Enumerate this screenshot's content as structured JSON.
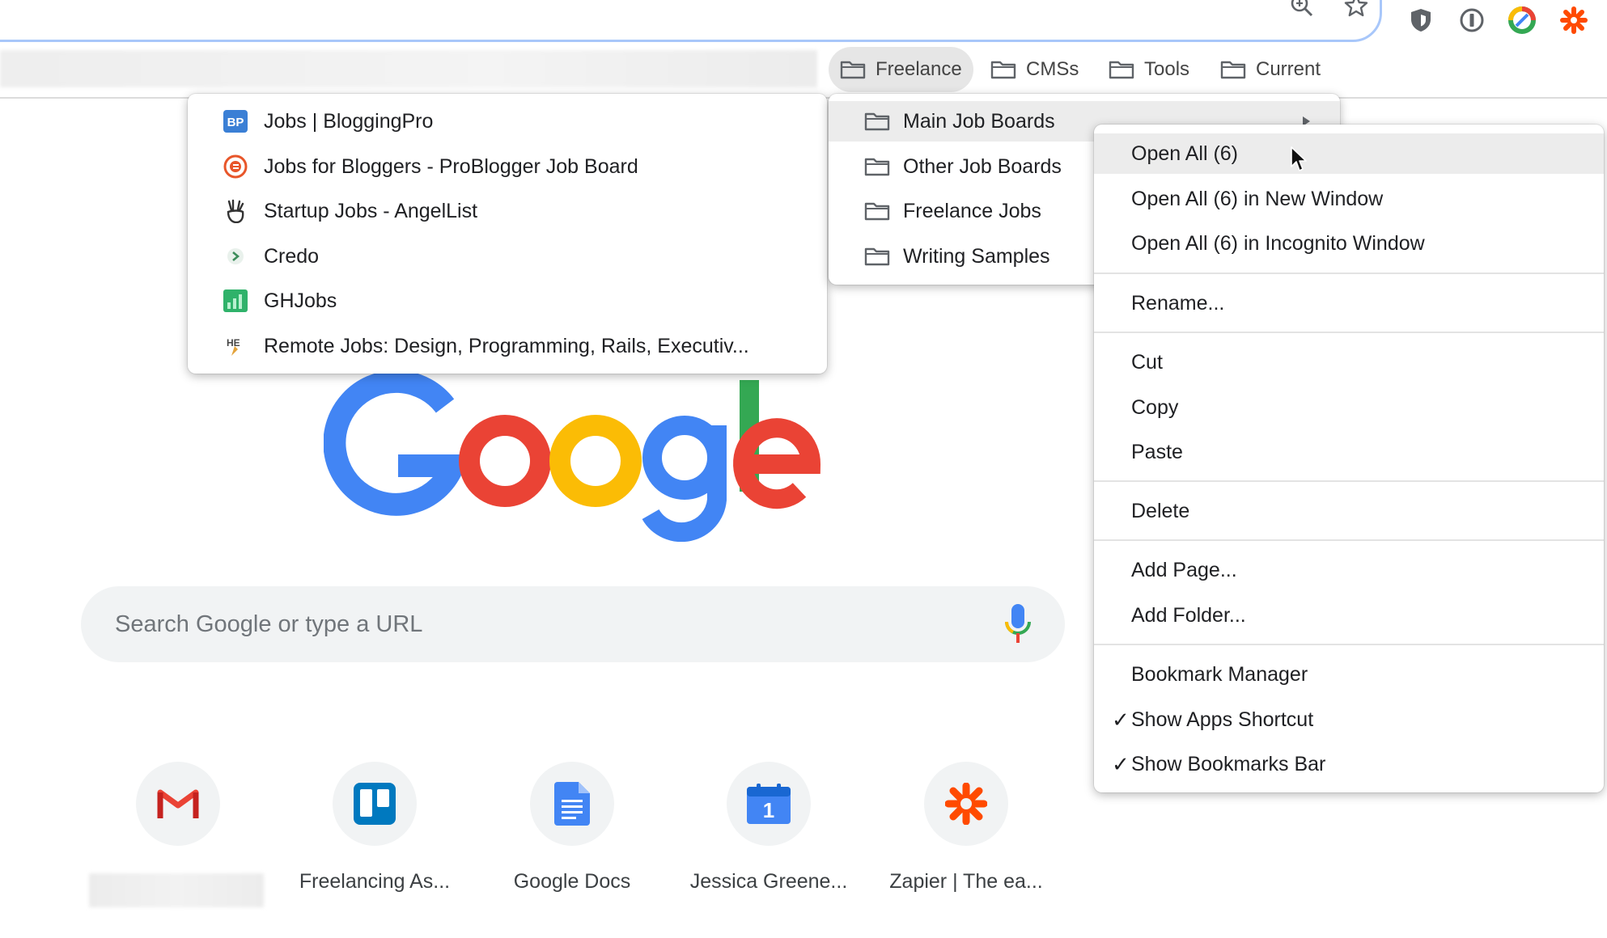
{
  "bookmarks_bar": {
    "folders": [
      {
        "label": "Freelance",
        "active": true
      },
      {
        "label": "CMSs"
      },
      {
        "label": "Tools"
      },
      {
        "label": "Current"
      }
    ]
  },
  "links_menu": {
    "items": [
      {
        "label": "Jobs | BloggingPro",
        "icon": "bloggingpro-icon"
      },
      {
        "label": "Jobs for Bloggers - ProBlogger Job Board",
        "icon": "problogger-icon"
      },
      {
        "label": "Startup Jobs - AngelList",
        "icon": "angellist-icon"
      },
      {
        "label": "Credo",
        "icon": "credo-icon"
      },
      {
        "label": "GHJobs",
        "icon": "ghjobs-icon"
      },
      {
        "label": "Remote Jobs: Design, Programming, Rails, Executiv...",
        "icon": "remote-jobs-icon"
      }
    ]
  },
  "folder_menu": {
    "items": [
      {
        "label": "Main Job Boards"
      },
      {
        "label": "Other Job Boards"
      },
      {
        "label": "Freelance Jobs"
      },
      {
        "label": "Writing Samples"
      }
    ]
  },
  "context_menu": {
    "open_all": "Open All (6)",
    "open_all_new_window": "Open All (6) in New Window",
    "open_all_incognito": "Open All (6) in Incognito Window",
    "rename": "Rename...",
    "cut": "Cut",
    "copy": "Copy",
    "paste": "Paste",
    "delete": "Delete",
    "add_page": "Add Page...",
    "add_folder": "Add Folder...",
    "bookmark_manager": "Bookmark Manager",
    "show_apps_shortcut": "Show Apps Shortcut",
    "show_bookmarks_bar": "Show Bookmarks Bar",
    "check_mark": "✓"
  },
  "search": {
    "placeholder": "Search Google or type a URL"
  },
  "shortcuts": [
    {
      "label": "",
      "icon": "gmail-icon"
    },
    {
      "label": "Freelancing As...",
      "icon": "trello-icon"
    },
    {
      "label": "Google Docs",
      "icon": "google-docs-icon"
    },
    {
      "label": "Jessica Greene...",
      "icon": "google-calendar-icon"
    },
    {
      "label": "Zapier | The ea...",
      "icon": "zapier-icon"
    }
  ],
  "calendar_day": "1",
  "colors": {
    "google_blue": "#4285F4",
    "google_red": "#EA4335",
    "google_yellow": "#FBBC05",
    "google_green": "#34A853",
    "zapier_orange": "#FF4A00"
  }
}
